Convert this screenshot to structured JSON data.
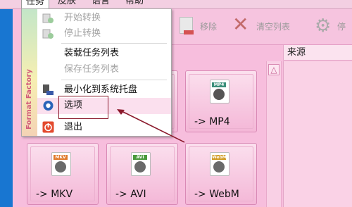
{
  "menubar": {
    "task": "任务",
    "skin": "皮肤",
    "language": "语言",
    "help": "帮助"
  },
  "toolbar": {
    "remove": "移除",
    "clear_list": "清空列表",
    "stop": "停"
  },
  "list": {
    "source_header": "来源"
  },
  "brand": {
    "text": "Format Factory"
  },
  "task_menu": {
    "items": [
      {
        "label": "开始转换",
        "enabled": false,
        "icon": "convert-start-icon"
      },
      {
        "label": "停止转换",
        "enabled": false,
        "icon": "convert-stop-icon"
      },
      {
        "label": "装载任务列表",
        "enabled": true,
        "icon": ""
      },
      {
        "label": "保存任务列表",
        "enabled": false,
        "icon": ""
      },
      {
        "label": "最小化到系统托盘",
        "enabled": true,
        "icon": "tray-icon"
      },
      {
        "label": "选项",
        "enabled": true,
        "icon": "options-icon",
        "hovered": true
      },
      {
        "label": "退出",
        "enabled": true,
        "icon": "power-icon"
      }
    ]
  },
  "formats": {
    "mp4": {
      "label": "-> MP4",
      "tag": "MP4"
    },
    "mkv": {
      "label": "-> MKV",
      "tag": "MKV"
    },
    "avi": {
      "label": "-> AVI",
      "tag": "AVI"
    },
    "webm": {
      "label": "-> WebM",
      "tag": "WebM"
    }
  },
  "colors": {
    "background": "#f7bedd",
    "accent_blue": "#1876d1",
    "highlight": "#8b1a2c"
  }
}
